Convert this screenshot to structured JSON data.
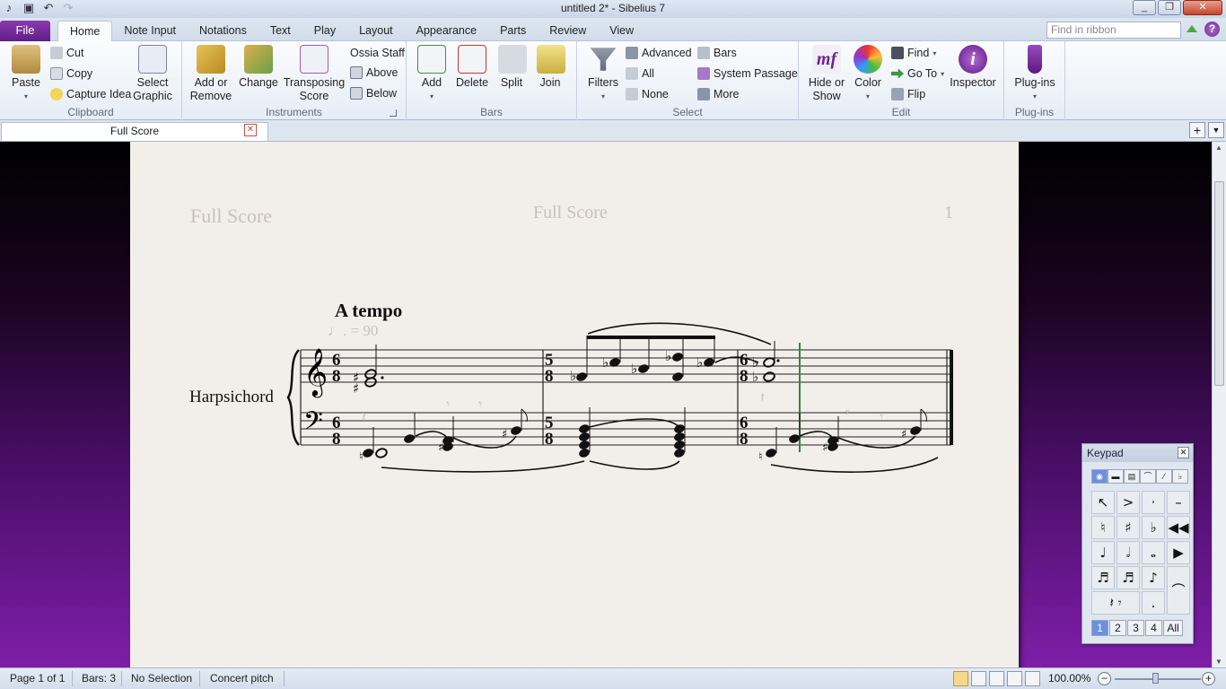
{
  "window": {
    "title": "untitled 2* - Sibelius 7"
  },
  "tabs": [
    "Note Input",
    "Notations",
    "Text",
    "Play",
    "Layout",
    "Appearance",
    "Parts",
    "Review",
    "View"
  ],
  "file_tab": "File",
  "home_tab": "Home",
  "find_placeholder": "Find in ribbon",
  "ribbon": {
    "clipboard": {
      "label": "Clipboard",
      "paste": "Paste",
      "cut": "Cut",
      "copy": "Copy",
      "capture": "Capture Idea",
      "select_graphic_1": "Select",
      "select_graphic_2": "Graphic"
    },
    "instruments": {
      "label": "Instruments",
      "add1": "Add or",
      "add2": "Remove",
      "change": "Change",
      "trans1": "Transposing",
      "trans2": "Score",
      "ossia": "Ossia Staff",
      "above": "Above",
      "below": "Below"
    },
    "bars": {
      "label": "Bars",
      "add": "Add",
      "delete": "Delete",
      "split": "Split",
      "join": "Join"
    },
    "select": {
      "label": "Select",
      "filters": "Filters",
      "advanced": "Advanced",
      "all": "All",
      "none": "None",
      "bars": "Bars",
      "system_passage": "System Passage",
      "more": "More"
    },
    "edit": {
      "label": "Edit",
      "hide1": "Hide or",
      "hide2": "Show",
      "color": "Color",
      "find": "Find",
      "goto": "Go To",
      "flip": "Flip",
      "inspector": "Inspector"
    },
    "plugins": {
      "label": "Plug-ins",
      "plugins": "Plug-ins"
    }
  },
  "document_tab": "Full Score",
  "score": {
    "header_left": "Full Score",
    "header_center": "Full Score",
    "page_number": "1",
    "tempo": "A tempo",
    "metronome": "♩. = 90",
    "instrument": "Harpsichord",
    "time_signatures": [
      "6/8",
      "5/8",
      "6/8"
    ]
  },
  "keypad": {
    "title": "Keypad",
    "layers": [
      "1",
      "2",
      "3",
      "4",
      "All"
    ]
  },
  "status": {
    "page": "Page 1 of 1",
    "bars": "Bars: 3",
    "selection": "No Selection",
    "pitch": "Concert pitch",
    "zoom": "100.00%"
  },
  "colors": {
    "file_tab": "#6a2490",
    "accent": "#4a0e68",
    "selection_line": "#2d8a3a"
  }
}
